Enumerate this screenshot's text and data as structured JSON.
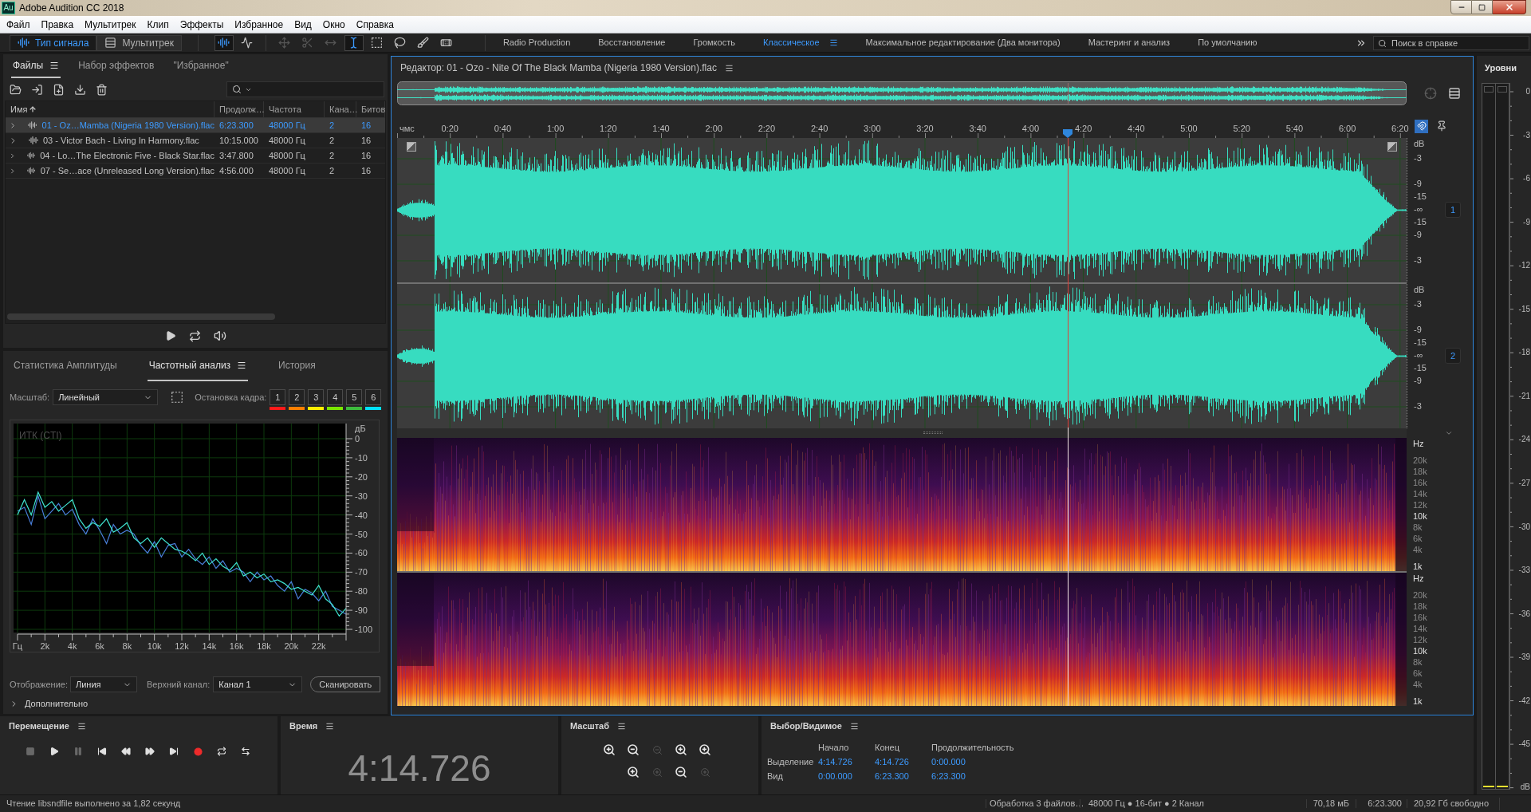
{
  "window": {
    "logo": "Au",
    "title": "Adobe Audition CC 2018"
  },
  "menu": [
    "Файл",
    "Правка",
    "Мультитрек",
    "Клип",
    "Эффекты",
    "Избранное",
    "Вид",
    "Окно",
    "Справка"
  ],
  "modes": [
    {
      "kind": "waveform",
      "label": "Тип сигнала",
      "selected": true
    },
    {
      "kind": "multitrack",
      "label": "Мультитрек",
      "selected": false
    }
  ],
  "tools": [
    {
      "kind": "waveform-view",
      "selected": true,
      "disabled": false
    },
    {
      "kind": "spectral-view",
      "selected": false,
      "disabled": false
    },
    {
      "kind": "move",
      "selected": false,
      "disabled": true
    },
    {
      "kind": "razor",
      "selected": false,
      "disabled": true
    },
    {
      "kind": "slip",
      "selected": false,
      "disabled": true
    },
    {
      "kind": "time-selection",
      "selected": true,
      "disabled": false
    },
    {
      "kind": "marquee",
      "selected": false,
      "disabled": false
    },
    {
      "kind": "lasso",
      "selected": false,
      "disabled": false
    },
    {
      "kind": "brush",
      "selected": false,
      "disabled": false
    },
    {
      "kind": "healing",
      "selected": false,
      "disabled": false
    }
  ],
  "workspaces": [
    {
      "label": "Radio Production",
      "selected": false
    },
    {
      "label": "Восстановление",
      "selected": false
    },
    {
      "label": "Громкость",
      "selected": false
    },
    {
      "label": "Классическое",
      "selected": true
    },
    {
      "label": "Максимальное редактирование (Два монитора)",
      "selected": false
    },
    {
      "label": "Мастеринг и анализ",
      "selected": false
    },
    {
      "label": "По умолчанию",
      "selected": false
    }
  ],
  "help_search": {
    "placeholder": "Поиск в справке"
  },
  "files_panel": {
    "tabs": [
      {
        "label": "Файлы",
        "selected": true
      },
      {
        "label": "Набор эффектов",
        "selected": false
      },
      {
        "label": "\"Избранное\"",
        "selected": false
      }
    ],
    "columns": [
      {
        "label": "Имя",
        "sorted": true
      },
      {
        "label": "Продолж…",
        "sorted": false
      },
      {
        "label": "Частота",
        "sorted": false
      },
      {
        "label": "Кана…",
        "sorted": false
      },
      {
        "label": "Битов",
        "sorted": false
      }
    ],
    "rows": [
      {
        "cells": [
          "01 - Oz…Mamba (Nigeria 1980 Version).flac",
          "6:23.300",
          "48000 Гц",
          "2",
          "16"
        ],
        "selected": true
      },
      {
        "cells": [
          "03 - Victor Bach - Living In Harmony.flac",
          "10:15.000",
          "48000 Гц",
          "2",
          "16"
        ],
        "selected": false
      },
      {
        "cells": [
          "04 - Lo…The Electronic Five - Black Star.flac",
          "3:47.800",
          "48000 Гц",
          "2",
          "16"
        ],
        "selected": false
      },
      {
        "cells": [
          "07 - Se…ace (Unreleased Long Version).flac",
          "4:56.000",
          "48000 Гц",
          "2",
          "16"
        ],
        "selected": false
      }
    ]
  },
  "freq_panel": {
    "tabs": [
      {
        "label": "Статистика Амплитуды",
        "selected": false
      },
      {
        "label": "Частотный анализ",
        "selected": true
      },
      {
        "label": "История",
        "selected": false
      }
    ],
    "scale_label": "Масштаб:",
    "scale_value": "Линейный",
    "freeze_label": "Остановка кадра:",
    "freeze_buttons": [
      {
        "label": "1",
        "color": "#ff1a1a"
      },
      {
        "label": "2",
        "color": "#ff7f00"
      },
      {
        "label": "3",
        "color": "#ffee00"
      },
      {
        "label": "4",
        "color": "#7ae600"
      },
      {
        "label": "5",
        "color": "#3dbb3d"
      },
      {
        "label": "6",
        "color": "#00e1ff"
      }
    ],
    "chart_data": {
      "type": "line",
      "title": "ИТК (CTI)",
      "ylabel": "дБ",
      "grid": true,
      "x": [
        0,
        500,
        1000,
        1500,
        2000,
        2500,
        3000,
        3500,
        4000,
        4500,
        5000,
        5500,
        6000,
        6500,
        7000,
        7500,
        8000,
        8500,
        9000,
        9500,
        10000,
        10500,
        11000,
        11500,
        12000,
        12500,
        13000,
        13500,
        14000,
        14500,
        15000,
        15500,
        16000,
        16500,
        17000,
        17500,
        18000,
        18500,
        19000,
        19500,
        20000,
        20500,
        21000,
        21500,
        22000,
        22500,
        23000,
        23500,
        24000
      ],
      "series": [
        {
          "color": "#4a80dc",
          "values": [
            -38,
            -36,
            -45,
            -30,
            -42,
            -38,
            -34,
            -40,
            -37,
            -45,
            -50,
            -42,
            -48,
            -55,
            -45,
            -50,
            -48,
            -50,
            -56,
            -60,
            -54,
            -62,
            -56,
            -55,
            -62,
            -58,
            -63,
            -66,
            -62,
            -68,
            -64,
            -70,
            -68,
            -70,
            -75,
            -70,
            -74,
            -72,
            -77,
            -80,
            -75,
            -84,
            -79,
            -81,
            -85,
            -80,
            -88,
            -90,
            -92
          ]
        },
        {
          "color": "#3fe3cf",
          "values": [
            -40,
            -32,
            -40,
            -28,
            -36,
            -33,
            -38,
            -35,
            -32,
            -42,
            -47,
            -44,
            -46,
            -42,
            -49,
            -47,
            -44,
            -52,
            -55,
            -52,
            -57,
            -52,
            -55,
            -58,
            -59,
            -61,
            -64,
            -60,
            -66,
            -63,
            -67,
            -69,
            -65,
            -72,
            -70,
            -73,
            -71,
            -75,
            -74,
            -76,
            -79,
            -78,
            -80,
            -82,
            -77,
            -84,
            -87,
            -93,
            -89
          ]
        }
      ],
      "xlim": [
        0,
        24000
      ],
      "ylim": [
        -100,
        0
      ],
      "xticks": [
        {
          "value": 0,
          "label": "Гц"
        },
        {
          "value": 2000,
          "label": "2k"
        },
        {
          "value": 4000,
          "label": "4k"
        },
        {
          "value": 6000,
          "label": "6k"
        },
        {
          "value": 8000,
          "label": "8k"
        },
        {
          "value": 10000,
          "label": "10k"
        },
        {
          "value": 12000,
          "label": "12k"
        },
        {
          "value": 14000,
          "label": "14k"
        },
        {
          "value": 16000,
          "label": "16k"
        },
        {
          "value": 18000,
          "label": "18k"
        },
        {
          "value": 20000,
          "label": "20k"
        },
        {
          "value": 22000,
          "label": "22k"
        }
      ],
      "yticks": [
        0,
        -10,
        -20,
        -30,
        -40,
        -50,
        -60,
        -70,
        -80,
        -90,
        -100
      ]
    },
    "display_label": "Отображение:",
    "display_value": "Линия",
    "channel_label": "Верхний канал:",
    "channel_value": "Канал 1",
    "scan_button": "Сканировать",
    "advanced": {
      "label": "Дополнительно",
      "expanded": false
    }
  },
  "editor": {
    "title": "Редактор: 01 - Ozo - Nite Of The Black Mamba (Nigeria 1980 Version).flac",
    "playhead": {
      "level": 0.6646
    },
    "ruler": {
      "unit": "чмс",
      "labels": [
        "0:20",
        "0:40",
        "1:00",
        "1:20",
        "1:40",
        "2:00",
        "2:20",
        "2:40",
        "3:00",
        "3:20",
        "3:40",
        "4:00",
        "4:20",
        "4:40",
        "5:00",
        "5:20",
        "5:40",
        "6:00",
        "6:20"
      ]
    },
    "channels": [
      {
        "badge": "1",
        "db_labels": [
          "dB",
          "-3",
          "-9",
          "-15",
          "-∞",
          "-15",
          "-9",
          "-3"
        ]
      },
      {
        "badge": "2",
        "db_labels": [
          "dB",
          "-3",
          "-9",
          "-15",
          "-∞",
          "-15",
          "-9",
          "-3"
        ]
      }
    ],
    "spectral": [
      {
        "hz_labels": [
          {
            "text": "Hz",
            "major": true
          },
          {
            "text": "20k",
            "major": false
          },
          {
            "text": "18k",
            "major": false
          },
          {
            "text": "16k",
            "major": false
          },
          {
            "text": "14k",
            "major": false
          },
          {
            "text": "12k",
            "major": false
          },
          {
            "text": "10k",
            "major": true
          },
          {
            "text": "8k",
            "major": false
          },
          {
            "text": "6k",
            "major": false
          },
          {
            "text": "4k",
            "major": false
          },
          {
            "text": "1k",
            "major": true
          }
        ]
      },
      {
        "hz_labels": [
          {
            "text": "Hz",
            "major": true
          },
          {
            "text": "20k",
            "major": false
          },
          {
            "text": "18k",
            "major": false
          },
          {
            "text": "16k",
            "major": false
          },
          {
            "text": "14k",
            "major": false
          },
          {
            "text": "12k",
            "major": false
          },
          {
            "text": "10k",
            "major": true
          },
          {
            "text": "8k",
            "major": false
          },
          {
            "text": "6k",
            "major": false
          },
          {
            "text": "4k",
            "major": false
          },
          {
            "text": "1k",
            "major": true
          }
        ]
      }
    ]
  },
  "meter": {
    "title": "Уровни",
    "scale": [
      "0",
      "-3",
      "-6",
      "-9",
      "-12",
      "-15",
      "-18",
      "-21",
      "-24",
      "-27",
      "-30",
      "-33",
      "-36",
      "-39",
      "-42",
      "-45",
      "dB"
    ],
    "channels": [
      {
        "level": 0
      },
      {
        "level": 0
      }
    ]
  },
  "transport_panel": {
    "title": "Перемещение",
    "buttons": [
      {
        "kind": "stop",
        "disabled": true
      },
      {
        "kind": "play",
        "disabled": false
      },
      {
        "kind": "pause",
        "disabled": true
      },
      {
        "kind": "to-start",
        "disabled": false
      },
      {
        "kind": "rewind",
        "disabled": false
      },
      {
        "kind": "fast-forward",
        "disabled": false
      },
      {
        "kind": "to-end",
        "disabled": false
      },
      {
        "kind": "record",
        "disabled": false
      },
      {
        "kind": "loop",
        "disabled": false
      },
      {
        "kind": "skip",
        "disabled": false
      }
    ]
  },
  "time_panel": {
    "title": "Время",
    "time": "4:14.726"
  },
  "zoom_panel": {
    "title": "Масштаб",
    "rows": [
      [
        {
          "kind": "amp-in",
          "disabled": false
        },
        {
          "kind": "amp-out",
          "disabled": false
        },
        {
          "kind": "out-full",
          "disabled": true
        },
        {
          "kind": "in-start",
          "disabled": false
        },
        {
          "kind": "in-both",
          "disabled": false
        }
      ],
      [
        {
          "kind": "time-in",
          "disabled": false
        },
        {
          "kind": "in-selection",
          "disabled": true
        },
        {
          "kind": "out-end",
          "disabled": false
        },
        {
          "kind": "in-playhead",
          "disabled": true
        }
      ]
    ]
  },
  "selection_panel": {
    "title": "Выбор/Видимое",
    "columns": [
      "Начало",
      "Конец",
      "Продолжительность"
    ],
    "rows": [
      {
        "label": "Выделение",
        "values": [
          "4:14.726",
          "4:14.726",
          "0:00.000"
        ]
      },
      {
        "label": "Вид",
        "values": [
          "0:00.000",
          "6:23.300",
          "6:23.300"
        ]
      }
    ]
  },
  "status_bar": {
    "message": "Чтение libsndfile выполнено за 1,82 секунд",
    "items": [
      "Обработка 3 файлов…",
      "48000 Гц ● 16-бит ● 2 Канал",
      "70,18 мБ",
      "6:23.300",
      "20,92 Гб свободно"
    ]
  }
}
